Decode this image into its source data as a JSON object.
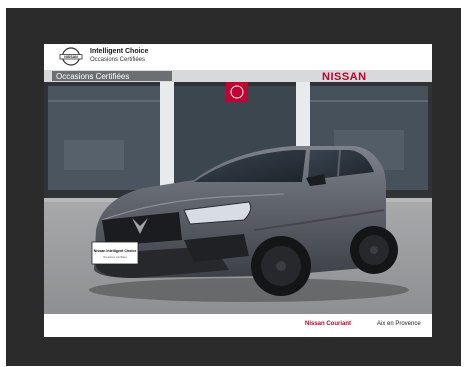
{
  "header": {
    "title": "Intelligent Choice",
    "subtitle": "Occasions Certifiées",
    "logo_text": "NISSAN"
  },
  "showroom": {
    "sign_left": "Occasions Certifiées",
    "sign_right": "NISSAN"
  },
  "plate": {
    "line1": "Nissan Intelligent Choice",
    "line2": "Occasions Certifiées"
  },
  "footer": {
    "dealer": "Nissan Couriant",
    "city": "Aix en Provence"
  },
  "colors": {
    "frame": "#2b2b2b",
    "brand_red": "#c3002f",
    "car_body": "#5c6068"
  }
}
